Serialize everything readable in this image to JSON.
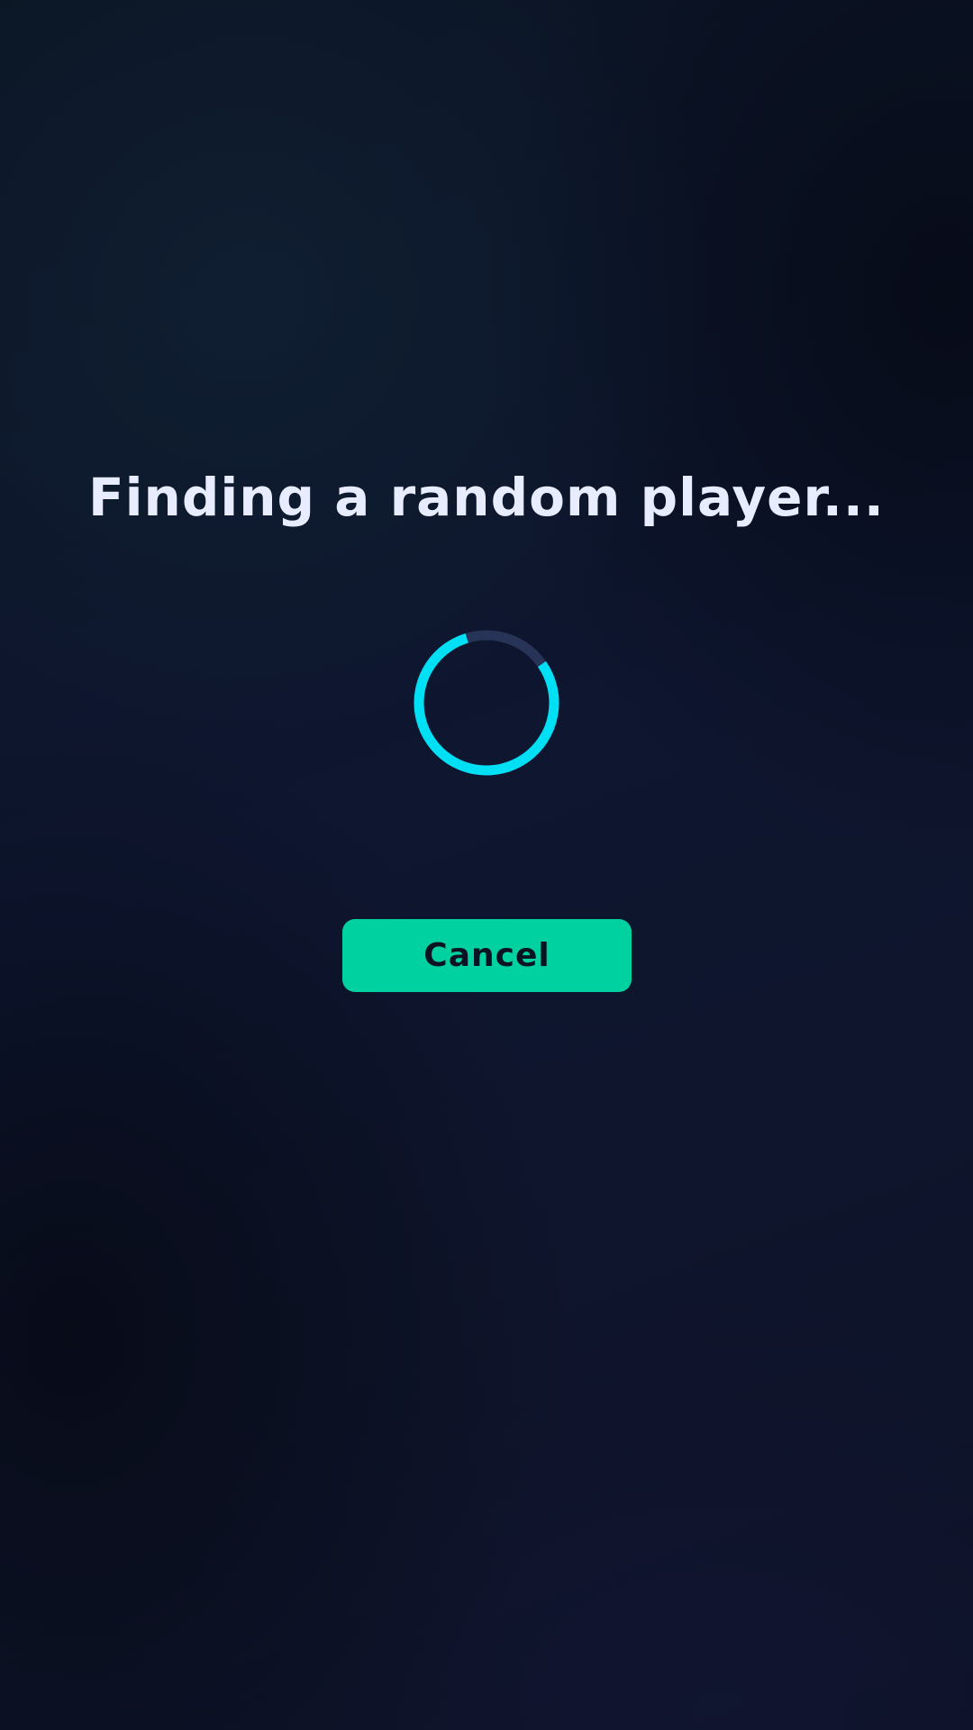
{
  "matchmaking": {
    "title": "Finding a random player...",
    "cancel_label": "Cancel"
  },
  "spinner": {
    "icon": "loading-spinner-icon",
    "progress_fraction": 0.8
  },
  "colors": {
    "title_text": "#e8ecff",
    "spinner_active": "#00e0f5",
    "spinner_track": "#283457",
    "button_background": "#00d1a0",
    "button_text": "#0b1322"
  }
}
